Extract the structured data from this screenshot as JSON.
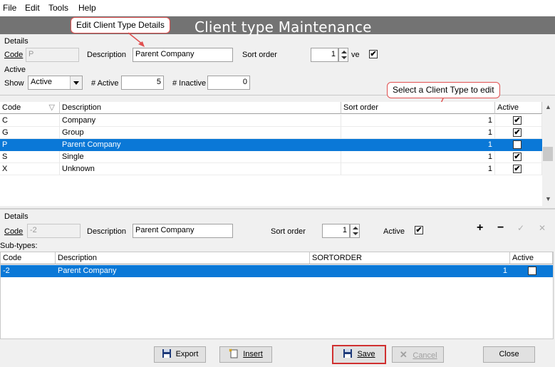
{
  "menu": {
    "items": [
      "File",
      "Edit",
      "Tools",
      "Help"
    ]
  },
  "title": "Client type Maintenance",
  "callouts": {
    "edit": "Edit Client Type Details",
    "select": "Select a Client Type to edit"
  },
  "details": {
    "group_label": "Details",
    "code_label": "Code",
    "code_value": "P",
    "description_label": "Description",
    "description_value": "Parent Company",
    "sort_order_label": "Sort order",
    "sort_order_value": "1",
    "active_label_short": "ve",
    "active_checked": true
  },
  "active_filter": {
    "group_label": "Active",
    "show_label": "Show",
    "show_value": "Active",
    "active_count_label": "# Active",
    "active_count": "5",
    "inactive_count_label": "# Inactive",
    "inactive_count": "0"
  },
  "types_grid": {
    "headers": [
      "Code",
      "Description",
      "Sort order",
      "Active"
    ],
    "rows": [
      {
        "code": "C",
        "description": "Company",
        "sort": "1",
        "active": true
      },
      {
        "code": "G",
        "description": "Group",
        "sort": "1",
        "active": true
      },
      {
        "code": "P",
        "description": "Parent Company",
        "sort": "1",
        "active": true,
        "selected": true
      },
      {
        "code": "S",
        "description": "Single",
        "sort": "1",
        "active": true
      },
      {
        "code": "X",
        "description": "Unknown",
        "sort": "1",
        "active": true
      }
    ]
  },
  "subtype_details": {
    "group_label": "Details",
    "code_label": "Code",
    "code_value": "-2",
    "description_label": "Description",
    "description_value": "Parent Company",
    "sort_order_label": "Sort order",
    "sort_order_value": "1",
    "active_label": "Active",
    "active_checked": true
  },
  "subtypes": {
    "label": "Sub-types:",
    "headers": [
      "Code",
      "Description",
      "SORTORDER",
      "Active"
    ],
    "rows": [
      {
        "code": "-2",
        "description": "Parent Company",
        "sort": "1",
        "active": true,
        "selected": true
      }
    ]
  },
  "buttons": {
    "export": "Export",
    "insert": "Insert",
    "save": "Save",
    "cancel": "Cancel",
    "close": "Close"
  },
  "colors": {
    "selection": "#0a78d7",
    "title_bar": "#737373",
    "callout_border": "#e05050",
    "save_border": "#d03030"
  }
}
